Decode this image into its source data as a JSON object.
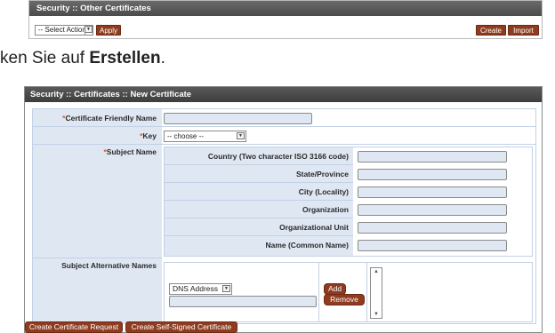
{
  "top_panel": {
    "title": "Security :: Other Certificates",
    "action_select": "-- Select Action --",
    "apply_label": "Apply",
    "create_label": "Create",
    "import_label": "Import"
  },
  "instruction": {
    "prefix": "ken Sie auf ",
    "bold": "Erstellen",
    "suffix": "."
  },
  "new_panel": {
    "title": "Security :: Certificates :: New Certificate",
    "fields": {
      "friendly_name": {
        "required": "*",
        "label": "Certificate Friendly Name",
        "value": ""
      },
      "key": {
        "required": "*",
        "label": "Key",
        "value": "-- choose --"
      },
      "subject_name": {
        "required": "*",
        "label": "Subject Name"
      },
      "subject_alt_names": {
        "label": "Subject Alternative Names"
      }
    },
    "subject": [
      {
        "label": "Country (Two character ISO 3166 code)",
        "value": ""
      },
      {
        "label": "State/Province",
        "value": ""
      },
      {
        "label": "City (Locality)",
        "value": ""
      },
      {
        "label": "Organization",
        "value": ""
      },
      {
        "label": "Organizational Unit",
        "value": ""
      },
      {
        "label": "Name (Common Name)",
        "value": ""
      }
    ],
    "san": {
      "type_select": "DNS Address",
      "value": "",
      "add_label": "Add",
      "remove_label": "Remove",
      "scroll_up": "▲",
      "scroll_down": "▼"
    },
    "buttons": {
      "create_request": "Create Certificate Request",
      "create_self_signed": "Create Self-Signed Certificate"
    }
  },
  "icons": {
    "dropdown": "chevron-down-icon"
  }
}
